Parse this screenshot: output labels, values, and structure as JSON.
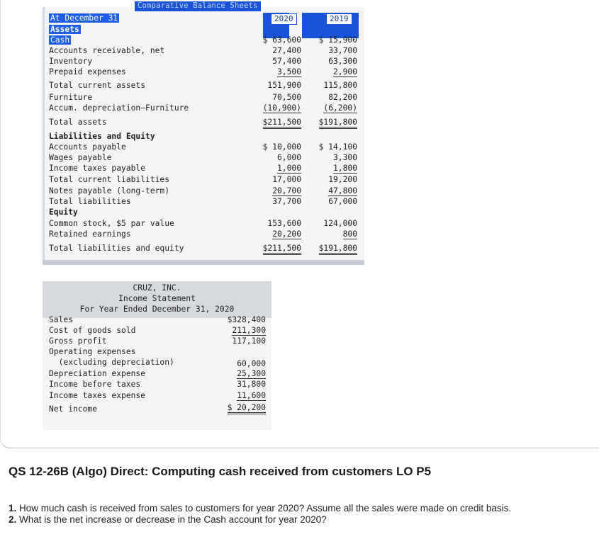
{
  "balance_sheet": {
    "title": "Comparative Balance Sheets",
    "date_label": "At December 31",
    "year1": "2020",
    "year2": "2019",
    "assets_label": "Assets",
    "rows": [
      {
        "label": "Cash",
        "v2020": "$ 63,600",
        "v2019": "$ 15,900"
      },
      {
        "label": "Accounts receivable, net",
        "v2020": "27,400",
        "v2019": "33,700"
      },
      {
        "label": "Inventory",
        "v2020": "57,400",
        "v2019": "63,300"
      },
      {
        "label": "Prepaid expenses",
        "v2020": "3,500",
        "v2019": "2,900"
      },
      {
        "label": "Total current assets",
        "v2020": "151,900",
        "v2019": "115,800"
      },
      {
        "label": "Furniture",
        "v2020": "70,500",
        "v2019": "82,200"
      },
      {
        "label": "Accum. depreciation—Furniture",
        "v2020": "(10,900)",
        "v2019": "(6,200)"
      },
      {
        "label": "Total assets",
        "v2020": "$211,500",
        "v2019": "$191,800"
      }
    ],
    "liab_label": "Liabilities and Equity",
    "liab_rows": [
      {
        "label": "Accounts payable",
        "v2020": "$ 10,000",
        "v2019": "$ 14,100"
      },
      {
        "label": "Wages payable",
        "v2020": "6,000",
        "v2019": "3,300"
      },
      {
        "label": "Income taxes payable",
        "v2020": "1,000",
        "v2019": "1,800"
      },
      {
        "label": "Total current liabilities",
        "v2020": "17,000",
        "v2019": "19,200"
      },
      {
        "label": "Notes payable (long-term)",
        "v2020": "20,700",
        "v2019": "47,800"
      },
      {
        "label": "Total liabilities",
        "v2020": "37,700",
        "v2019": "67,000"
      }
    ],
    "equity_label": "Equity",
    "equity_rows": [
      {
        "label": "Common stock, $5 par value",
        "v2020": "153,600",
        "v2019": "124,000"
      },
      {
        "label": "Retained earnings",
        "v2020": "20,200",
        "v2019": "800"
      },
      {
        "label": "Total liabilities and equity",
        "v2020": "$211,500",
        "v2019": "$191,800"
      }
    ]
  },
  "income_statement": {
    "company": "CRUZ, INC.",
    "title": "Income Statement",
    "period": "For Year Ended December 31, 2020",
    "rows": [
      {
        "label": "Sales",
        "value": "$328,400"
      },
      {
        "label": "Cost of goods sold",
        "value": "211,300"
      },
      {
        "label": "Gross profit",
        "value": "117,100"
      },
      {
        "label": "Operating expenses",
        "value": ""
      },
      {
        "label": "  (excluding depreciation)",
        "value": "60,000"
      },
      {
        "label": "Depreciation expense",
        "value": "25,300"
      },
      {
        "label": "Income before taxes",
        "value": "31,800"
      },
      {
        "label": "Income taxes expense",
        "value": "11,600"
      },
      {
        "label": "Net income",
        "value": "$ 20,200"
      }
    ]
  },
  "question": {
    "title": "QS 12-26B (Algo) Direct: Computing cash received from customers LO P5",
    "item1_num": "1.",
    "item1_text": "How much cash is received from sales to customers for year 2020? Assume all the sales were made on credit basis.",
    "item2_num": "2.",
    "item2_text": "What is the net increase or decrease in the Cash account for year 2020?"
  }
}
